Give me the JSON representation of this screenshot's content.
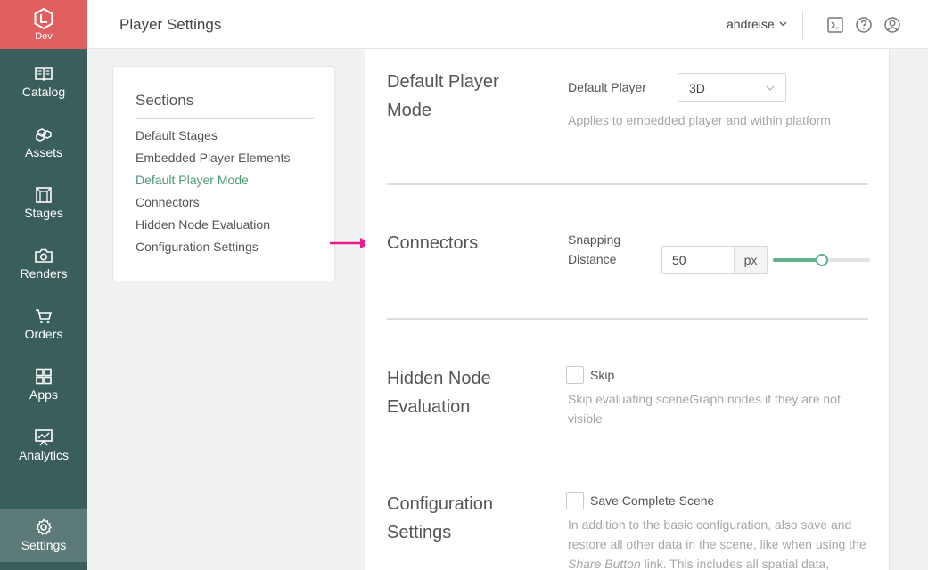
{
  "sidebar": {
    "brand": {
      "env_label": "Dev"
    },
    "items": [
      {
        "label": "Catalog",
        "icon": "book-icon"
      },
      {
        "label": "Assets",
        "icon": "cubes-icon"
      },
      {
        "label": "Stages",
        "icon": "stage-icon"
      },
      {
        "label": "Renders",
        "icon": "camera-icon"
      },
      {
        "label": "Orders",
        "icon": "cart-icon"
      },
      {
        "label": "Apps",
        "icon": "grid-icon"
      },
      {
        "label": "Analytics",
        "icon": "chart-icon"
      },
      {
        "label": "Settings",
        "icon": "gear-icon",
        "active": true
      }
    ]
  },
  "header": {
    "title": "Player Settings",
    "user": "andreise",
    "icons": [
      "terminal-icon",
      "help-icon",
      "user-icon"
    ]
  },
  "sections": {
    "title": "Sections",
    "links": [
      {
        "label": "Default Stages"
      },
      {
        "label": "Embedded Player Elements"
      },
      {
        "label": "Default Player Mode",
        "active": true
      },
      {
        "label": "Connectors"
      },
      {
        "label": "Hidden Node Evaluation"
      },
      {
        "label": "Configuration Settings"
      }
    ]
  },
  "main": {
    "default_player_mode": {
      "heading": "Default Player Mode",
      "field_label": "Default Player",
      "selected": "3D",
      "help": "Applies to embedded player and within platform"
    },
    "connectors": {
      "heading": "Connectors",
      "field_label": "Snapping Distance",
      "value": "50",
      "unit": "px",
      "slider_fraction": 0.5
    },
    "hidden_node": {
      "heading": "Hidden Node Evaluation",
      "checkbox_label": "Skip",
      "checked": false,
      "help": "Skip evaluating sceneGraph nodes if they are not visible"
    },
    "configuration": {
      "heading": "Configuration Settings",
      "checkbox_label": "Save Complete Scene",
      "checked": false,
      "help_before": "In addition to the basic configuration, also save and restore all other data in the scene, like when using the ",
      "help_emphasis": "Share Button",
      "help_after": " link. This includes all spatial data,"
    }
  },
  "colors": {
    "sidebar": "#3a5e5c",
    "brand": "#e0605f",
    "accent": "#4a9a74",
    "annotation_arrow": "#e91e8c"
  }
}
